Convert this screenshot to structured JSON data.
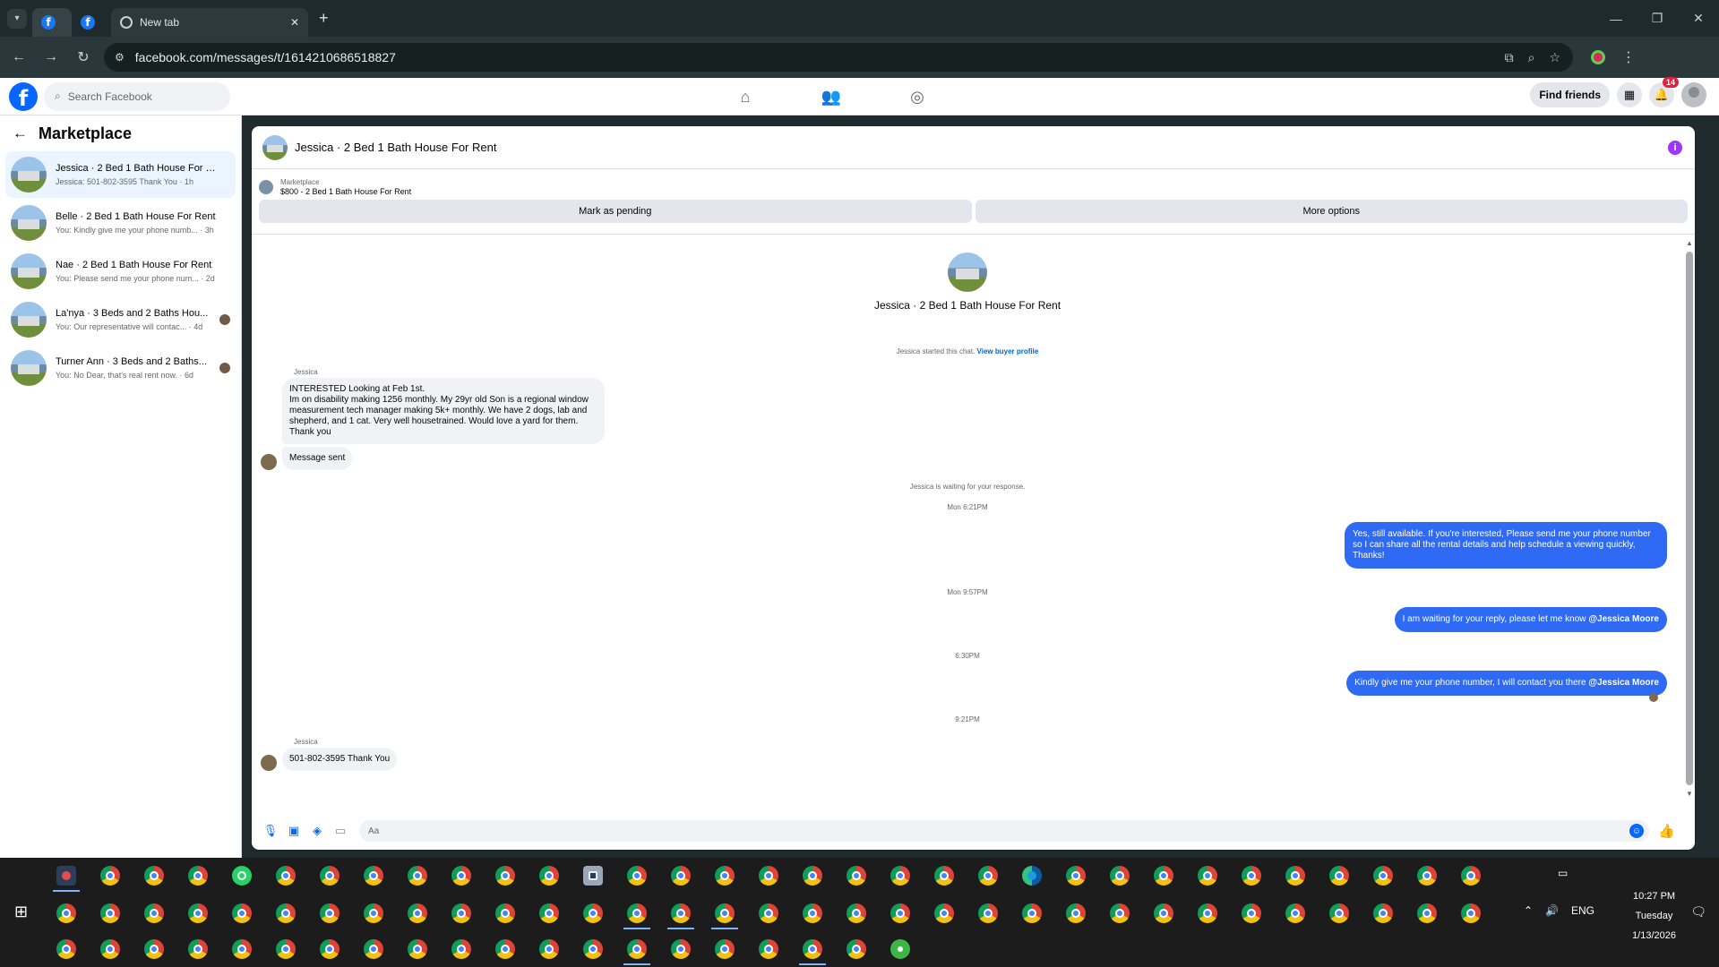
{
  "browser": {
    "tabs": [
      {
        "kind": "facebook",
        "label": ""
      },
      {
        "kind": "facebook",
        "label": ""
      },
      {
        "kind": "newtab",
        "label": "New tab"
      }
    ],
    "url": "facebook.com/messages/t/1614210686518827"
  },
  "fb_header": {
    "search_placeholder": "Search Facebook",
    "find_friends": "Find friends",
    "notifications_count": "14"
  },
  "sidebar": {
    "title": "Marketplace",
    "conversations": [
      {
        "name": "Jessica · 2 Bed 1 Bath House For R...",
        "preview": "Jessica: 501-802-3595 Thank You · 1h",
        "active": true
      },
      {
        "name": "Belle · 2 Bed 1 Bath House For Rent",
        "preview": "You: Kindly give me your phone numb... · 3h"
      },
      {
        "name": "Nae · 2 Bed 1 Bath House For Rent",
        "preview": "You: Please send me your phone num... · 2d"
      },
      {
        "name": "La'nya · 3 Beds and 2 Baths Hou...",
        "preview": "You: Our representative will contac... · 4d"
      },
      {
        "name": "Turner Ann · 3 Beds and 2 Baths...",
        "preview": "You: No Dear, that's real rent now. · 6d"
      }
    ]
  },
  "chat": {
    "title": "Jessica · 2 Bed 1 Bath House For Rent",
    "listing_source": "Marketplace",
    "listing_name": "$800 - 2 Bed 1 Bath House For Rent",
    "mark_pending": "Mark as pending",
    "more_options": "More options",
    "intro_title": "Jessica · 2 Bed 1 Bath House For Rent",
    "started_text": "Jessica started this chat.",
    "view_profile": "View buyer profile",
    "sender_name": "Jessica",
    "msg1_line1": "INTERESTED Looking at Feb 1st.",
    "msg1_line2": "Im on disability making 1256 monthly. My 29yr old Son is a regional window measurement tech manager making 5k+ monthly. We have 2 dogs, lab and shepherd,  and 1 cat. Very well housetrained. Would love a yard for them.",
    "msg1_line3": "Thank you",
    "msg2": "Message sent",
    "waiting": "Jessica is waiting for your response.",
    "ts1": "Mon 6:21PM",
    "out1": "Yes, still available. If you're interested, Please send me your phone number so I can share all the rental details and help schedule a viewing quickly, Thanks!",
    "ts2": "Mon 9:57PM",
    "out2_text": "I am waiting for your reply, please let me know ",
    "out2_mention": "@Jessica Moore",
    "ts3": "6:30PM",
    "out3_text": "Kindly give me your phone number, I will contact you there ",
    "out3_mention": "@Jessica Moore",
    "ts4": "9:21PM",
    "sender_name2": "Jessica",
    "msg_last": "501-802-3595 Thank You",
    "composer_placeholder": "Aa"
  },
  "taskbar": {
    "time": "10:27 PM",
    "day": "Tuesday",
    "date": "1/13/2026",
    "lang": "ENG"
  }
}
